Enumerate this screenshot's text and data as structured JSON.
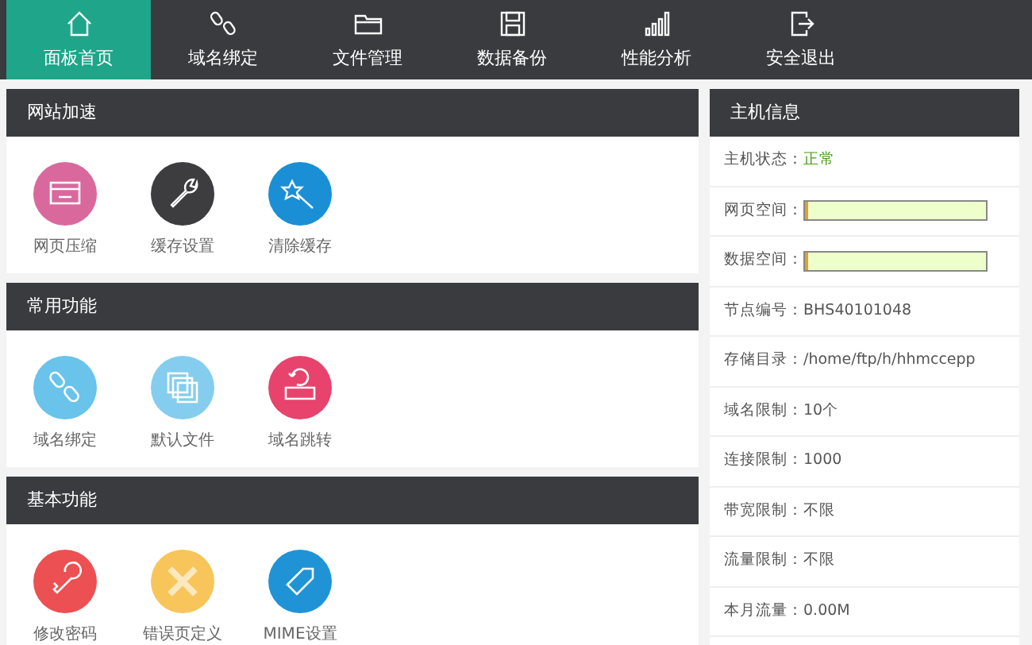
{
  "nav": [
    {
      "label": "面板首页",
      "selected": true
    },
    {
      "label": "域名绑定",
      "selected": false
    },
    {
      "label": "文件管理",
      "selected": false
    },
    {
      "label": "数据备份",
      "selected": false
    },
    {
      "label": "性能分析",
      "selected": false
    },
    {
      "label": "安全退出",
      "selected": false
    }
  ],
  "sections": [
    {
      "title": "网站加速",
      "items": [
        {
          "label": "网页压缩",
          "color": "#d9699d"
        },
        {
          "label": "缓存设置",
          "color": "#3d3d3f"
        },
        {
          "label": "清除缓存",
          "color": "#1a8fd6"
        }
      ]
    },
    {
      "title": "常用功能",
      "items": [
        {
          "label": "域名绑定",
          "color": "#69c3ea"
        },
        {
          "label": "默认文件",
          "color": "#84cdee"
        },
        {
          "label": "域名跳转",
          "color": "#e7436d"
        }
      ]
    },
    {
      "title": "基本功能",
      "items": [
        {
          "label": "修改密码",
          "color": "#ec5052"
        },
        {
          "label": "错误页定义",
          "color": "#f7c55a"
        },
        {
          "label": "MIME设置",
          "color": "#1f93d6"
        }
      ]
    }
  ],
  "host_info": {
    "title": "主机信息",
    "rows": [
      {
        "kind": "status",
        "label": "主机状态：",
        "value": "正常"
      },
      {
        "kind": "bar",
        "label": "网页空间：",
        "level": 0.01
      },
      {
        "kind": "bar",
        "label": "数据空间：",
        "level": 0.01
      },
      {
        "kind": "text",
        "label": "节点编号：",
        "value": "BHS40101048"
      },
      {
        "kind": "text",
        "label": "存储目录：",
        "value": "/home/ftp/h/hhmccepp"
      },
      {
        "kind": "text",
        "label": "域名限制：",
        "value": "10个"
      },
      {
        "kind": "text",
        "label": "连接限制：",
        "value": "1000"
      },
      {
        "kind": "text",
        "label": "带宽限制：",
        "value": "不限"
      },
      {
        "kind": "text",
        "label": "流量限制：",
        "value": "不限"
      },
      {
        "kind": "text",
        "label": "本月流量：",
        "value": "0.00M"
      }
    ]
  }
}
